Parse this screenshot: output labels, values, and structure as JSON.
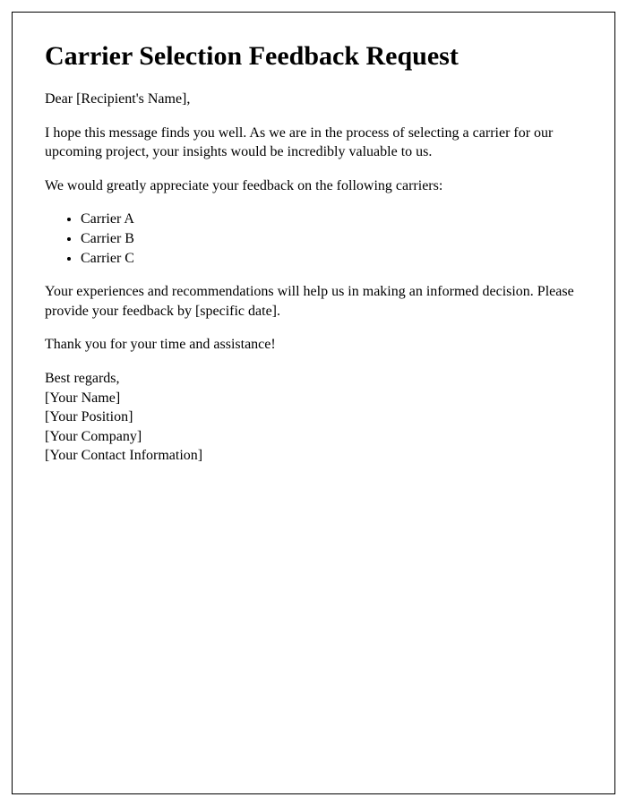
{
  "title": "Carrier Selection Feedback Request",
  "salutation": "Dear [Recipient's Name],",
  "intro": "I hope this message finds you well. As we are in the process of selecting a carrier for our upcoming project, your insights would be incredibly valuable to us.",
  "request_line": "We would greatly appreciate your feedback on the following carriers:",
  "carriers": [
    "Carrier A",
    "Carrier B",
    "Carrier C"
  ],
  "followup": "Your experiences and recommendations will help us in making an informed decision. Please provide your feedback by [specific date].",
  "thanks": "Thank you for your time and assistance!",
  "closing": "Best regards,",
  "sender": {
    "name": "[Your Name]",
    "position": "[Your Position]",
    "company": "[Your Company]",
    "contact": "[Your Contact Information]"
  }
}
